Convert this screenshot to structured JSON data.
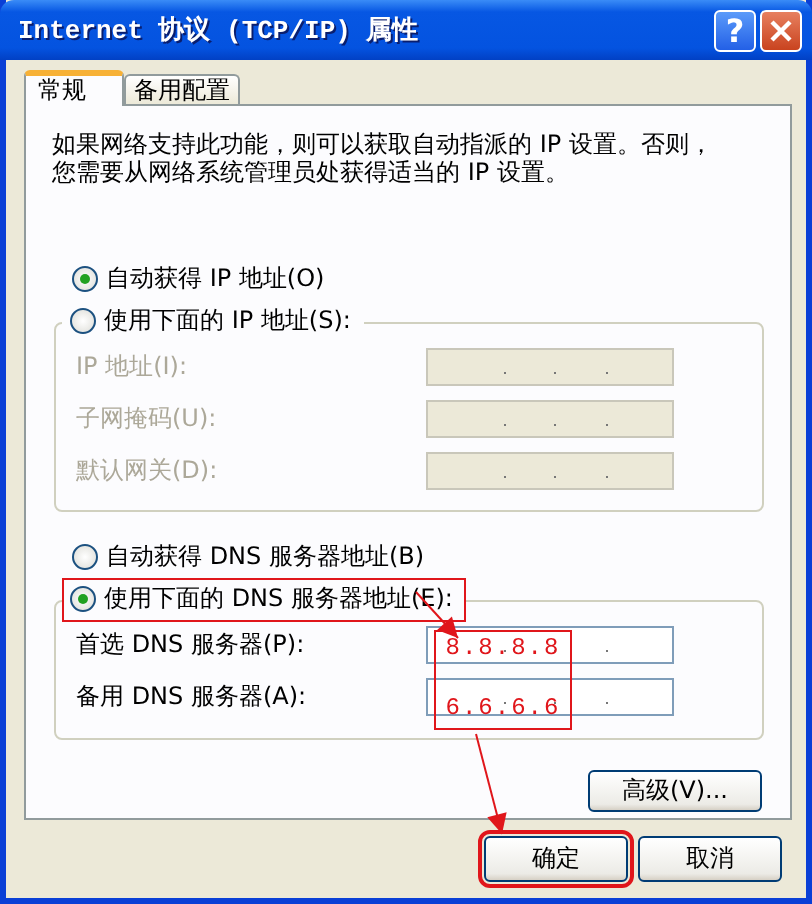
{
  "window": {
    "title": "Internet 协议 (TCP/IP) 属性",
    "help_label": "?"
  },
  "tabs": [
    {
      "label": "常规",
      "selected": true
    },
    {
      "label": "备用配置",
      "selected": false
    }
  ],
  "description": [
    "如果网络支持此功能，则可以获取自动指派的 IP 设置。否则，",
    "您需要从网络系统管理员处获得适当的 IP 设置。"
  ],
  "ip_mode": [
    {
      "label": "自动获得 IP 地址(O)",
      "selected": true,
      "highlighted": false
    },
    {
      "label": "使用下面的 IP 地址(S):",
      "selected": false,
      "highlighted": false
    }
  ],
  "ip_fields": [
    {
      "label": "IP 地址(I):",
      "disabled": true
    },
    {
      "label": "子网掩码(U):",
      "disabled": true
    },
    {
      "label": "默认网关(D):",
      "disabled": true
    }
  ],
  "dns_mode": [
    {
      "label": "自动获得 DNS 服务器地址(B)",
      "selected": false,
      "highlighted": false
    },
    {
      "label": "使用下面的 DNS 服务器地址(E):",
      "selected": true,
      "highlighted": true
    }
  ],
  "dns_fields": [
    {
      "label": "首选 DNS 服务器(P):",
      "disabled": false
    },
    {
      "label": "备用 DNS 服务器(A):",
      "disabled": false
    }
  ],
  "advanced_button": "高级(V)...",
  "buttons": [
    {
      "label": "确定",
      "highlighted": true
    },
    {
      "label": "取消",
      "highlighted": false
    }
  ],
  "annotation": {
    "values": [
      "8.8.8.8",
      "6.6.6.6"
    ]
  }
}
